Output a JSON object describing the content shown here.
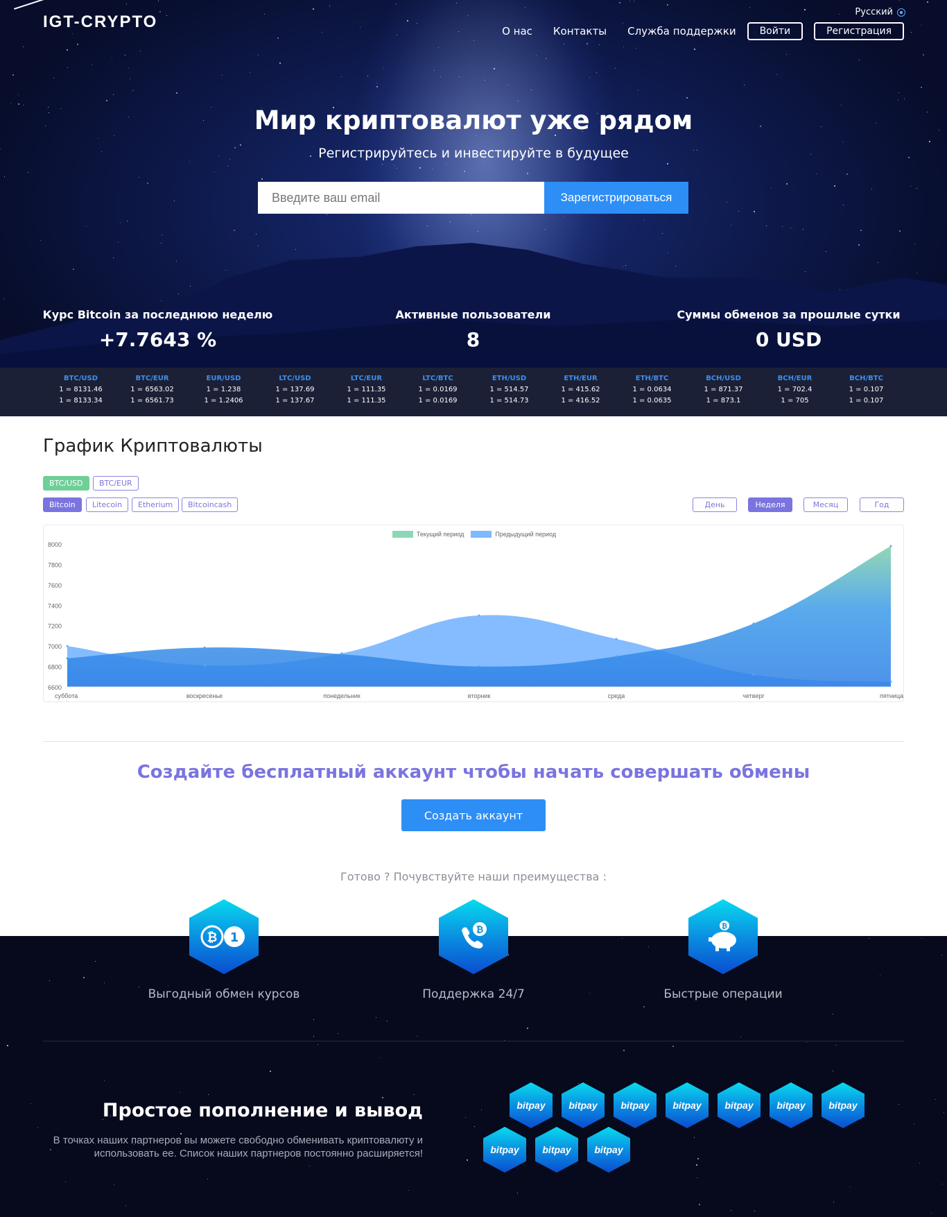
{
  "header": {
    "logo": "IGT-CRYPTO",
    "language": "Русский",
    "nav": [
      {
        "label": "О нас"
      },
      {
        "label": "Контакты"
      },
      {
        "label": "Служба поддержки"
      }
    ],
    "login_label": "Войти",
    "register_label": "Регистрация"
  },
  "hero": {
    "title": "Мир криптовалют уже рядом",
    "subtitle": "Регистрируйтесь и инвестируйте в будущее",
    "email_placeholder": "Введите ваш email",
    "submit_label": "Зарегистрироваться"
  },
  "stats": [
    {
      "label": "Курс Bitcoin за последнюю неделю",
      "value": "+7.7643 %"
    },
    {
      "label": "Активные пользователи",
      "value": "8"
    },
    {
      "label": "Суммы обменов за прошлые сутки",
      "value": "0 USD"
    }
  ],
  "ticker": [
    {
      "pair": "BTC/USD",
      "buy": "1 = 8131.46",
      "sell": "1 = 8133.34"
    },
    {
      "pair": "BTC/EUR",
      "buy": "1 = 6563.02",
      "sell": "1 = 6561.73"
    },
    {
      "pair": "EUR/USD",
      "buy": "1 = 1.238",
      "sell": "1 = 1.2406"
    },
    {
      "pair": "LTC/USD",
      "buy": "1 = 137.69",
      "sell": "1 = 137.67"
    },
    {
      "pair": "LTC/EUR",
      "buy": "1 = 111.35",
      "sell": "1 = 111.35"
    },
    {
      "pair": "LTC/BTC",
      "buy": "1 = 0.0169",
      "sell": "1 = 0.0169"
    },
    {
      "pair": "ETH/USD",
      "buy": "1 = 514.57",
      "sell": "1 = 514.73"
    },
    {
      "pair": "ETH/EUR",
      "buy": "1 = 415.62",
      "sell": "1 = 416.52"
    },
    {
      "pair": "ETH/BTC",
      "buy": "1 = 0.0634",
      "sell": "1 = 0.0635"
    },
    {
      "pair": "BCH/USD",
      "buy": "1 = 871.37",
      "sell": "1 = 873.1"
    },
    {
      "pair": "BCH/EUR",
      "buy": "1 = 702.4",
      "sell": "1 = 705"
    },
    {
      "pair": "BCH/BTC",
      "buy": "1 = 0.107",
      "sell": "1 = 0.107"
    }
  ],
  "chart_section": {
    "title": "График Криптовалюты",
    "currency_tabs": [
      "BTC/USD",
      "BTC/EUR"
    ],
    "coin_tabs": [
      "Bitcoin",
      "Litecoin",
      "Etherium",
      "Bitcoincash"
    ],
    "period_tabs": [
      "День",
      "Неделя",
      "Месяц",
      "Год"
    ],
    "active_currency": "BTC/USD",
    "active_coin": "Bitcoin",
    "active_period": "Неделя"
  },
  "chart_data": {
    "type": "area",
    "x": [
      "суббота",
      "воскресенье",
      "понедельник",
      "вторник",
      "среда",
      "четверг",
      "пятница"
    ],
    "series": [
      {
        "name": "Текущий период",
        "values": [
          6880,
          6985,
          6920,
          6800,
          6900,
          7220,
          7980
        ],
        "color": "#7fd0a8"
      },
      {
        "name": "Предыдущий период",
        "values": [
          7000,
          6810,
          6930,
          7300,
          7070,
          6720,
          6650
        ],
        "color": "#5aa6ff"
      }
    ],
    "ylim": [
      6600,
      8000
    ],
    "yticks": [
      6600,
      6800,
      7000,
      7200,
      7400,
      7600,
      7800,
      8000
    ],
    "legend": "top-center"
  },
  "cta": {
    "title": "Создайте бесплатный аккаунт чтобы начать совершать обмены",
    "button": "Создать аккаунт",
    "advantages_heading": "Готово ? Почувствуйте наши преимущества :"
  },
  "features": [
    {
      "label": "Выгодный обмен курсов",
      "icon": "bitcoin-exchange-icon"
    },
    {
      "label": "Поддержка 24/7",
      "icon": "phone-support-icon"
    },
    {
      "label": "Быстрые операции",
      "icon": "piggy-bank-icon"
    }
  ],
  "payments": {
    "title": "Простое пополнение и вывод",
    "text": "В точках наших партнеров вы можете свободно обменивать криптовалюту и использовать ее. Список наших партнеров постоянно расширяется!",
    "partners": [
      "bitpay",
      "bitpay",
      "bitpay",
      "bitpay",
      "bitpay",
      "bitpay",
      "bitpay",
      "bitpay",
      "bitpay",
      "bitpay"
    ]
  }
}
